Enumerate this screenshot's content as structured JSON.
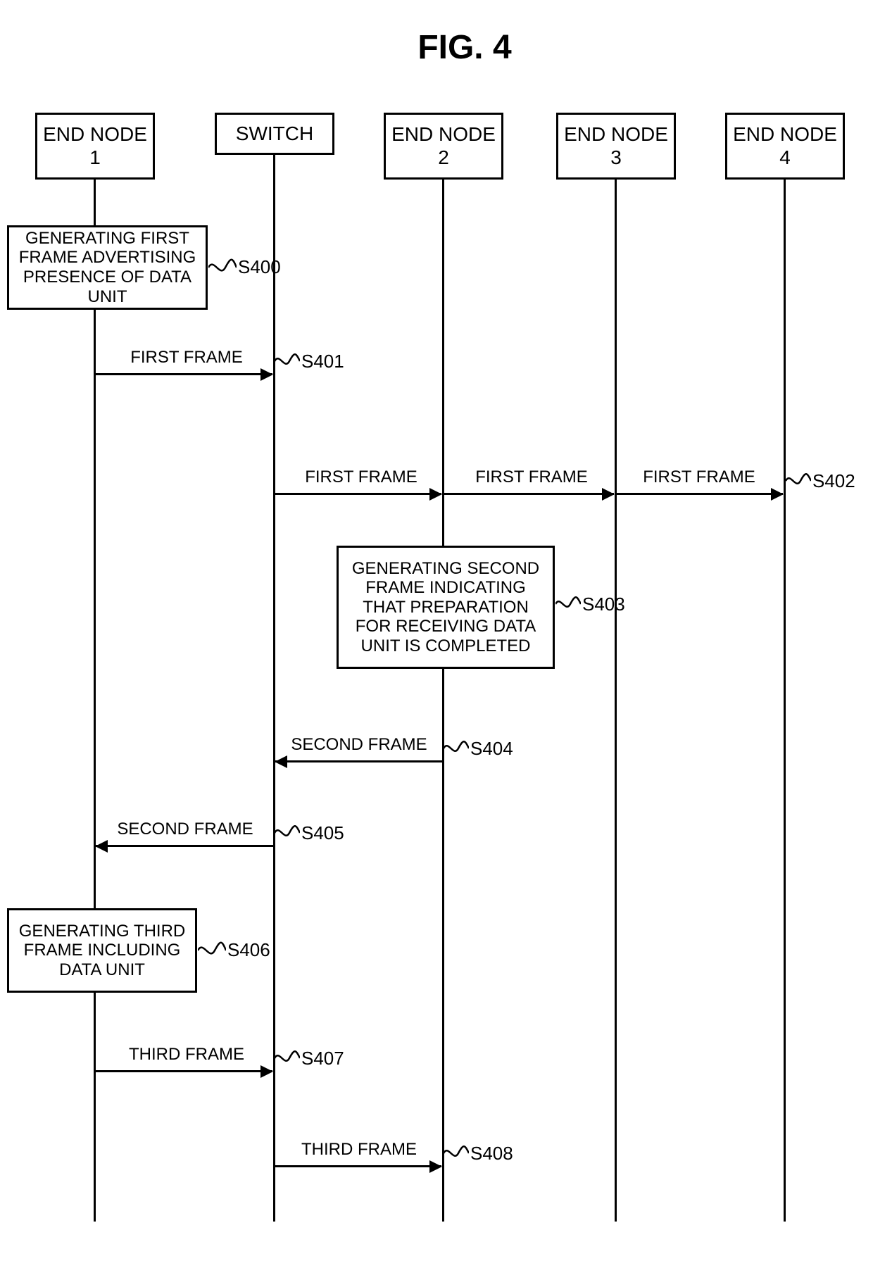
{
  "figure": {
    "title": "FIG. 4"
  },
  "nodes": {
    "end1": "END NODE\n1",
    "switch": "SWITCH",
    "end2": "END NODE\n2",
    "end3": "END NODE\n3",
    "end4": "END NODE\n4"
  },
  "proc": {
    "s400": "GENERATING FIRST FRAME ADVERTISING PRESENCE OF DATA UNIT",
    "s403": "GENERATING SECOND FRAME INDICATING THAT PREPARATION FOR RECEIVING DATA UNIT IS COMPLETED",
    "s406": "GENERATING THIRD FRAME INCLUDING DATA UNIT"
  },
  "msg": {
    "e1_sw_first": "FIRST FRAME",
    "sw_e2_first": "FIRST FRAME",
    "sw_e3_first": "FIRST FRAME",
    "sw_e4_first": "FIRST FRAME",
    "e2_sw_second": "SECOND FRAME",
    "sw_e1_second": "SECOND FRAME",
    "e1_sw_third": "THIRD FRAME",
    "sw_e2_third": "THIRD FRAME"
  },
  "steps": {
    "s400": "S400",
    "s401": "S401",
    "s402": "S402",
    "s403": "S403",
    "s404": "S404",
    "s405": "S405",
    "s406": "S406",
    "s407": "S407",
    "s408": "S408"
  }
}
